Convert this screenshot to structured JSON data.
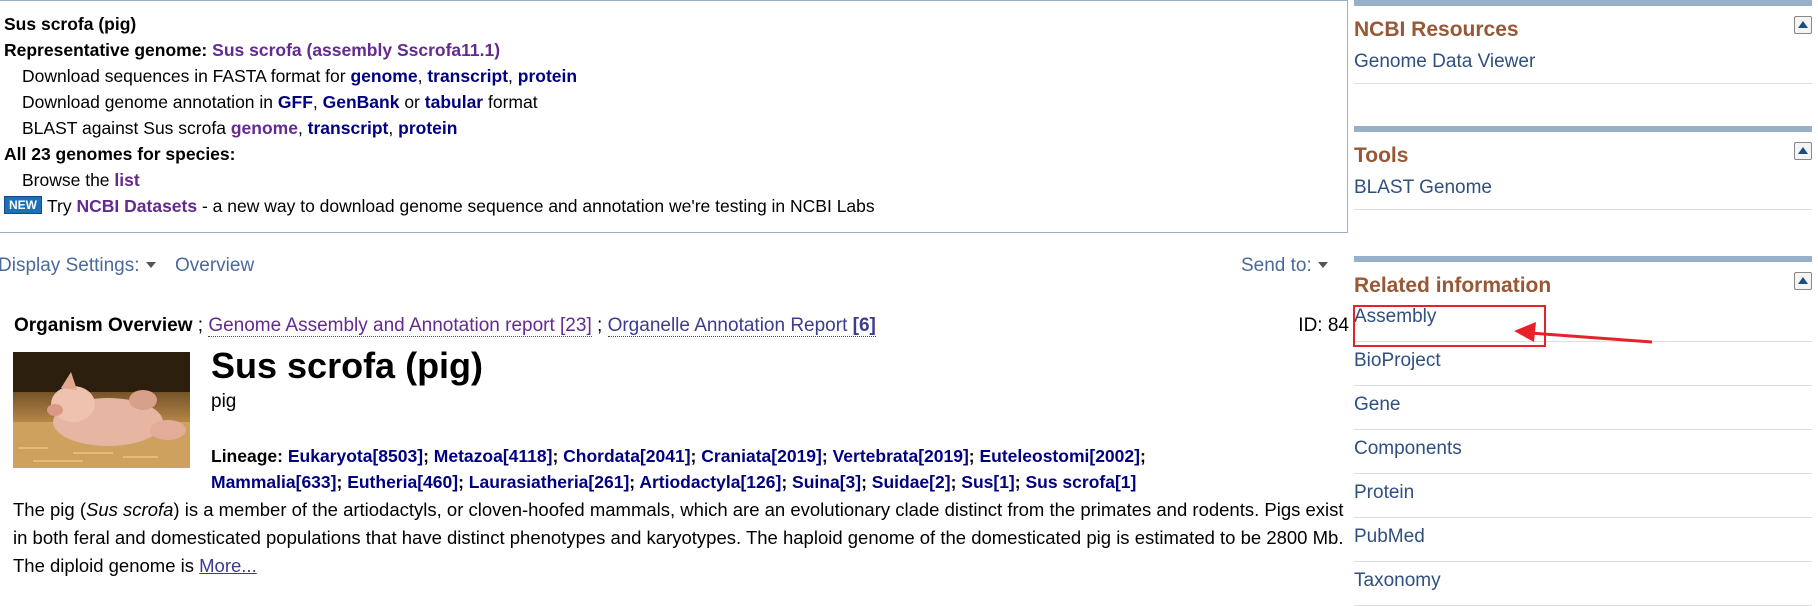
{
  "summary": {
    "organism": "Sus scrofa (pig)",
    "rep_label": "Representative genome:",
    "rep_link": "Sus scrofa (assembly Sscrofa11.1)",
    "download_fasta": "Download sequences in FASTA format for",
    "fasta_genome": "genome",
    "fasta_transcript": "transcript",
    "fasta_protein": "protein",
    "download_annot": "Download genome annotation in",
    "annot_gff": "GFF",
    "annot_genbank": "GenBank",
    "annot_or": "or",
    "annot_tabular": "tabular",
    "annot_format": "format",
    "blast_text": "BLAST against Sus scrofa",
    "blast_genome": "genome",
    "blast_transcript": "transcript",
    "blast_protein": "protein",
    "all_genomes": "All 23 genomes for species:",
    "browse_text": "Browse the",
    "browse_list": "list",
    "new_badge": "NEW",
    "try_text": "Try",
    "datasets_link": "NCBI Datasets",
    "datasets_desc": "- a new way to download genome sequence and annotation we're testing in NCBI Labs"
  },
  "display": {
    "settings_label": "Display Settings:",
    "overview": "Overview",
    "send_to": "Send to:"
  },
  "report": {
    "organism_overview": "Organism Overview",
    "sep1": ";",
    "assembly_report": "Genome Assembly and Annotation report",
    "assembly_count": "[23]",
    "sep2": ";",
    "organelle_report": "Organelle Annotation Report",
    "organelle_count": "[6]",
    "id": "ID: 84"
  },
  "organism": {
    "title": "Sus scrofa (pig)",
    "common": "pig",
    "lineage_label": "Lineage:",
    "lineage": [
      {
        "name": "Eukaryota",
        "count": "[8503]"
      },
      {
        "name": "Metazoa",
        "count": "[4118]"
      },
      {
        "name": "Chordata",
        "count": "[2041]"
      },
      {
        "name": "Craniata",
        "count": "[2019]"
      },
      {
        "name": "Vertebrata",
        "count": "[2019]"
      },
      {
        "name": "Euteleostomi",
        "count": "[2002]"
      },
      {
        "name": "Mammalia",
        "count": "[633]"
      },
      {
        "name": "Eutheria",
        "count": "[460]"
      },
      {
        "name": "Laurasiatheria",
        "count": "[261]"
      },
      {
        "name": "Artiodactyla",
        "count": "[126]"
      },
      {
        "name": "Suina",
        "count": "[3]"
      },
      {
        "name": "Suidae",
        "count": "[2]"
      },
      {
        "name": "Sus",
        "count": "[1]"
      },
      {
        "name": "Sus scrofa",
        "count": "[1]"
      }
    ],
    "desc_pre": "The pig (",
    "desc_italic": "Sus scrofa",
    "desc_post": ") is a member of the artiodactyls, or cloven-hoofed mammals, which are an evolutionary clade distinct from the primates and rodents. Pigs exist in both feral and domesticated populations that have distinct phenotypes and karyotypes. The haploid genome of the domesticated pig is estimated to be 2800 Mb. The diploid genome is",
    "more": "More..."
  },
  "sidebar": {
    "resources_title": "NCBI Resources",
    "resources_items": [
      "Genome Data Viewer"
    ],
    "tools_title": "Tools",
    "tools_items": [
      "BLAST Genome"
    ],
    "related_title": "Related information",
    "related_items": [
      "Assembly",
      "BioProject",
      "Gene",
      "Components",
      "Protein",
      "PubMed",
      "Taxonomy"
    ]
  },
  "colors": {
    "link_dark": "#000080",
    "link_visited": "#642a8f",
    "portlet_header": "#985735",
    "portlet_bar": "#97b0c8",
    "highlight": "#e8202a"
  }
}
